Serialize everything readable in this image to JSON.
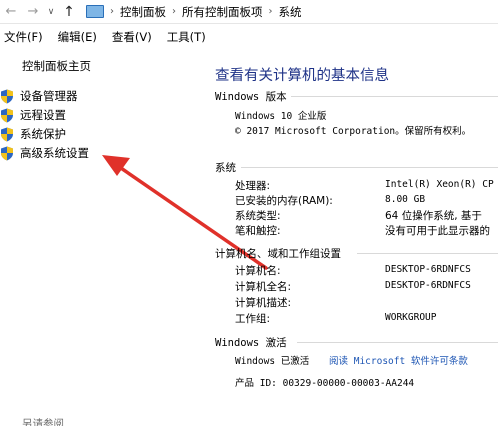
{
  "address_bar": {
    "back_glyph": "←",
    "forward_glyph": "→",
    "recent_glyph": "∨",
    "up_glyph": "↑",
    "crumb_separator": "›",
    "crumbs": [
      "控制面板",
      "所有控制面板项",
      "系统"
    ]
  },
  "menu": [
    "文件(F)",
    "编辑(E)",
    "查看(V)",
    "工具(T)"
  ],
  "sidebar": {
    "home": "控制面板主页",
    "links": [
      "设备管理器",
      "远程设置",
      "系统保护",
      "高级系统设置"
    ],
    "see_also": "另请参阅"
  },
  "main": {
    "title": "查看有关计算机的基本信息",
    "windows_edition": {
      "heading": "Windows 版本",
      "edition": "Windows 10 企业版",
      "copyright": "© 2017 Microsoft Corporation。保留所有权利。"
    },
    "system": {
      "heading": "系统",
      "rows": [
        {
          "label": "处理器:",
          "value": "Intel(R) Xeon(R) CP"
        },
        {
          "label": "已安装的内存(RAM):",
          "value": "8.00 GB"
        },
        {
          "label": "系统类型:",
          "value": "64 位操作系统, 基于"
        },
        {
          "label": "笔和触控:",
          "value": "没有可用于此显示器的"
        }
      ]
    },
    "computer_name": {
      "heading": "计算机名、域和工作组设置",
      "rows": [
        {
          "label": "计算机名:",
          "value": "DESKTOP-6RDNFCS"
        },
        {
          "label": "计算机全名:",
          "value": "DESKTOP-6RDNFCS"
        },
        {
          "label": "计算机描述:",
          "value": ""
        },
        {
          "label": "工作组:",
          "value": "WORKGROUP"
        }
      ]
    },
    "activation": {
      "heading": "Windows 激活",
      "status": "Windows 已激活",
      "license_link": "阅读 Microsoft 软件许可条款",
      "product_id": "产品 ID: 00329-00000-00003-AA244"
    }
  },
  "colors": {
    "title": "#1e3287",
    "link": "#1e56b4",
    "arrow": "#e0312a"
  }
}
